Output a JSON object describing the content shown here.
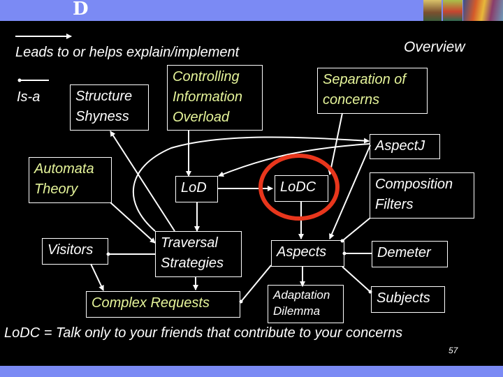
{
  "header": {
    "logo_glyph": "D",
    "art_label": "header-artwork"
  },
  "slide": {
    "title": "Overview",
    "page_number": "57",
    "legend": {
      "leads_to": "Leads to or helps explain/implement",
      "is_a": "Is-a"
    },
    "nodes": {
      "structure_shyness": [
        "Structure",
        "Shyness"
      ],
      "controlling_info": [
        "Controlling",
        "Information",
        "Overload"
      ],
      "separation": [
        "Separation of",
        "concerns"
      ],
      "aspectj": "AspectJ",
      "automata": [
        "Automata",
        "Theory"
      ],
      "lod": "LoD",
      "lodc": "LoDC",
      "composition": [
        "Composition",
        "Filters"
      ],
      "visitors": "Visitors",
      "traversal": [
        "Traversal",
        "Strategies"
      ],
      "aspects": "Aspects",
      "demeter": "Demeter",
      "complex": "Complex Requests",
      "adaptation": [
        "Adaptation",
        "Dilemma"
      ],
      "subjects": "Subjects"
    },
    "footer": "LoDC  = Talk only to your friends that contribute to your concerns"
  },
  "colors": {
    "band": "#7b8af4",
    "highlight_ring": "#e8361c",
    "yellow_text": "#e6f59a",
    "background": "#000000"
  }
}
